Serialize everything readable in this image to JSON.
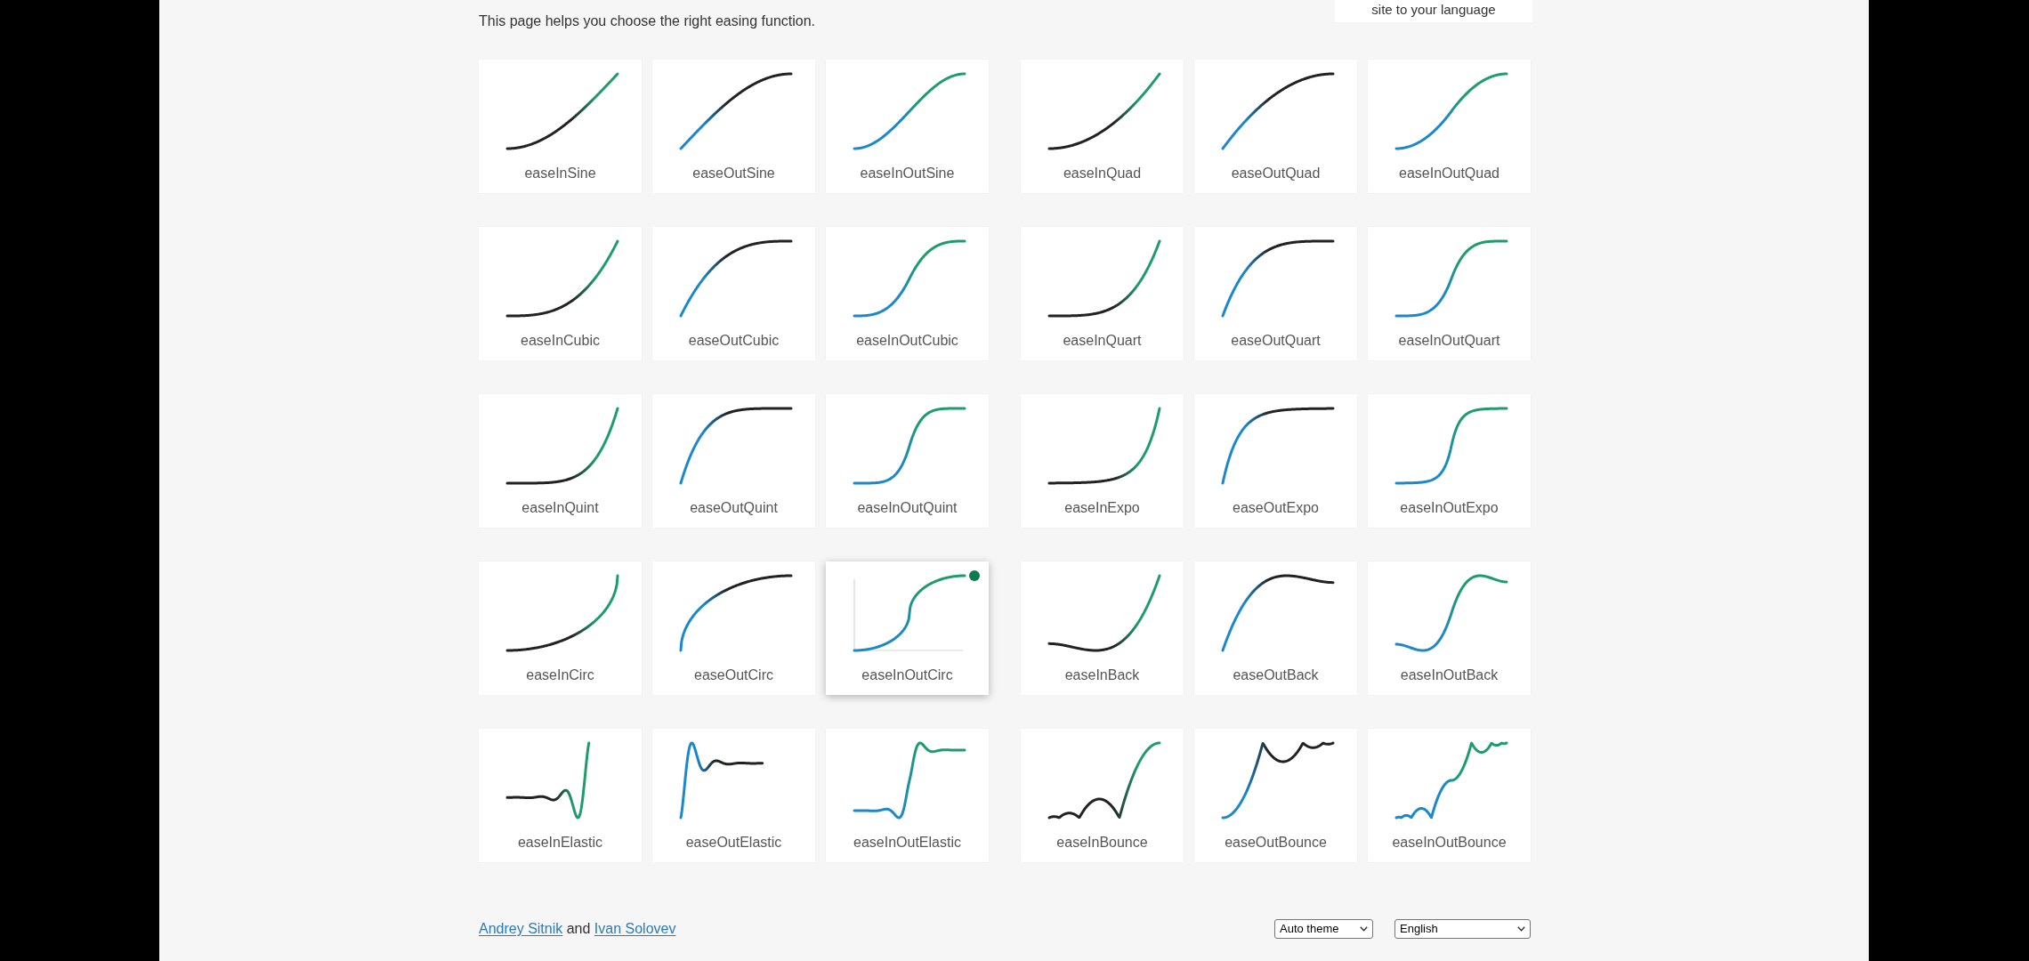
{
  "intro": "This page helps you choose the right easing function.",
  "language_hint": "site to your language",
  "cards": [
    {
      "name": "easeInSine",
      "kind": "sine",
      "ease_in": true,
      "ease_out": false,
      "hovered": false
    },
    {
      "name": "easeOutSine",
      "kind": "sine",
      "ease_in": false,
      "ease_out": true,
      "hovered": false
    },
    {
      "name": "easeInOutSine",
      "kind": "sine",
      "ease_in": true,
      "ease_out": true,
      "hovered": false
    },
    {
      "name": "easeInQuad",
      "kind": "quad",
      "ease_in": true,
      "ease_out": false,
      "hovered": false
    },
    {
      "name": "easeOutQuad",
      "kind": "quad",
      "ease_in": false,
      "ease_out": true,
      "hovered": false
    },
    {
      "name": "easeInOutQuad",
      "kind": "quad",
      "ease_in": true,
      "ease_out": true,
      "hovered": false
    },
    {
      "name": "easeInCubic",
      "kind": "cubic",
      "ease_in": true,
      "ease_out": false,
      "hovered": false
    },
    {
      "name": "easeOutCubic",
      "kind": "cubic",
      "ease_in": false,
      "ease_out": true,
      "hovered": false
    },
    {
      "name": "easeInOutCubic",
      "kind": "cubic",
      "ease_in": true,
      "ease_out": true,
      "hovered": false
    },
    {
      "name": "easeInQuart",
      "kind": "quart",
      "ease_in": true,
      "ease_out": false,
      "hovered": false
    },
    {
      "name": "easeOutQuart",
      "kind": "quart",
      "ease_in": false,
      "ease_out": true,
      "hovered": false
    },
    {
      "name": "easeInOutQuart",
      "kind": "quart",
      "ease_in": true,
      "ease_out": true,
      "hovered": false
    },
    {
      "name": "easeInQuint",
      "kind": "quint",
      "ease_in": true,
      "ease_out": false,
      "hovered": false
    },
    {
      "name": "easeOutQuint",
      "kind": "quint",
      "ease_in": false,
      "ease_out": true,
      "hovered": false
    },
    {
      "name": "easeInOutQuint",
      "kind": "quint",
      "ease_in": true,
      "ease_out": true,
      "hovered": false
    },
    {
      "name": "easeInExpo",
      "kind": "expo",
      "ease_in": true,
      "ease_out": false,
      "hovered": false
    },
    {
      "name": "easeOutExpo",
      "kind": "expo",
      "ease_in": false,
      "ease_out": true,
      "hovered": false
    },
    {
      "name": "easeInOutExpo",
      "kind": "expo",
      "ease_in": true,
      "ease_out": true,
      "hovered": false
    },
    {
      "name": "easeInCirc",
      "kind": "circ",
      "ease_in": true,
      "ease_out": false,
      "hovered": false
    },
    {
      "name": "easeOutCirc",
      "kind": "circ",
      "ease_in": false,
      "ease_out": true,
      "hovered": false
    },
    {
      "name": "easeInOutCirc",
      "kind": "circ",
      "ease_in": true,
      "ease_out": true,
      "hovered": true
    },
    {
      "name": "easeInBack",
      "kind": "back",
      "ease_in": true,
      "ease_out": false,
      "hovered": false
    },
    {
      "name": "easeOutBack",
      "kind": "back",
      "ease_in": false,
      "ease_out": true,
      "hovered": false
    },
    {
      "name": "easeInOutBack",
      "kind": "back",
      "ease_in": true,
      "ease_out": true,
      "hovered": false
    },
    {
      "name": "easeInElastic",
      "kind": "elastic",
      "ease_in": true,
      "ease_out": false,
      "hovered": false
    },
    {
      "name": "easeOutElastic",
      "kind": "elastic",
      "ease_in": false,
      "ease_out": true,
      "hovered": false
    },
    {
      "name": "easeInOutElastic",
      "kind": "elastic",
      "ease_in": true,
      "ease_out": true,
      "hovered": false
    },
    {
      "name": "easeInBounce",
      "kind": "bounce",
      "ease_in": true,
      "ease_out": false,
      "hovered": false
    },
    {
      "name": "easeOutBounce",
      "kind": "bounce",
      "ease_in": false,
      "ease_out": true,
      "hovered": false
    },
    {
      "name": "easeInOutBounce",
      "kind": "bounce",
      "ease_in": true,
      "ease_out": true,
      "hovered": false
    }
  ],
  "footer": {
    "authors": [
      "Andrey Sitnik",
      "Ivan Solovev"
    ],
    "conjunction": "and",
    "theme_select": {
      "value": "Auto theme"
    },
    "language_select": {
      "value": "English"
    }
  }
}
